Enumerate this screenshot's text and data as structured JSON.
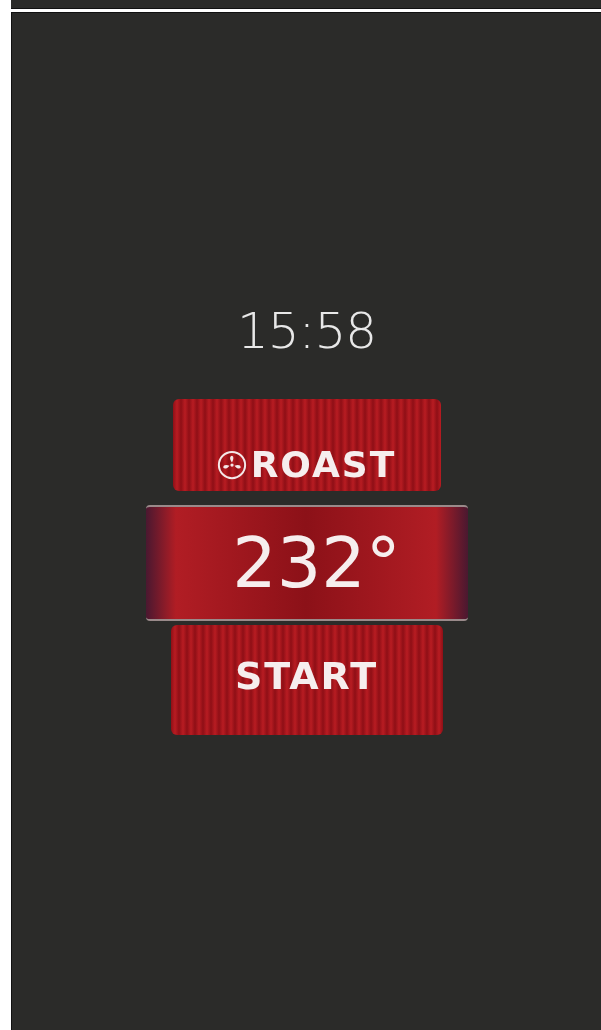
{
  "clock": "15:58",
  "program": {
    "label": "ROAST"
  },
  "temperature": "232°",
  "start_button": {
    "label": "START"
  }
}
